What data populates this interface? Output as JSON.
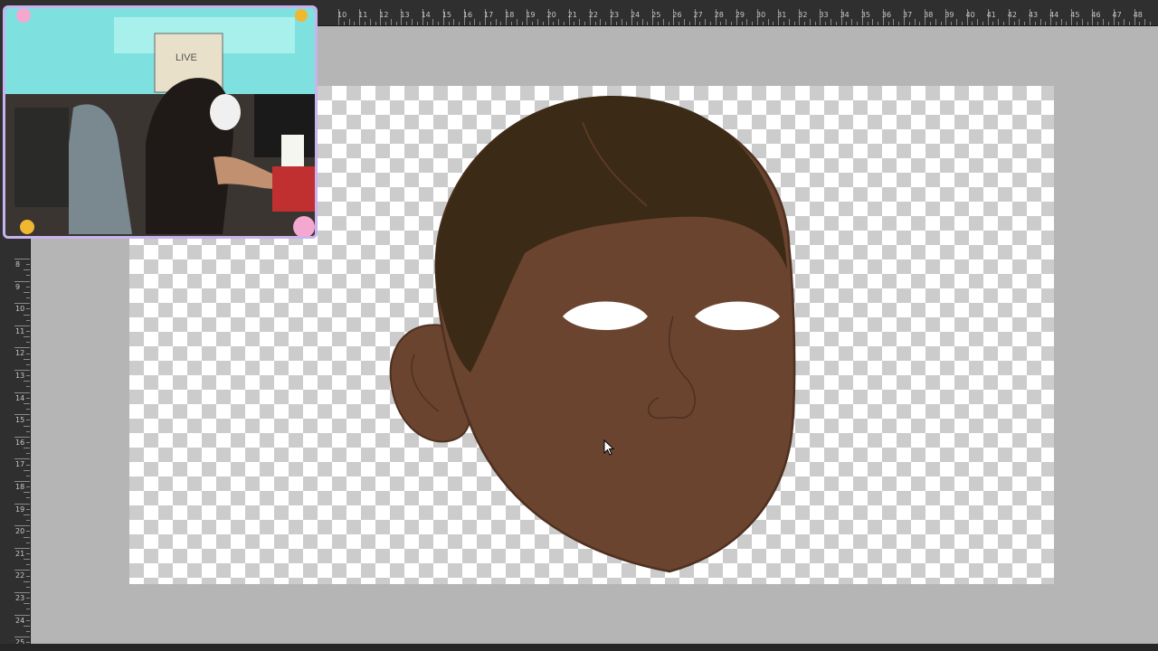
{
  "rulers": {
    "top_labels": [
      "10",
      "11",
      "12",
      "13",
      "14",
      "15",
      "16",
      "17",
      "18",
      "19",
      "20",
      "21",
      "22",
      "23",
      "24",
      "25",
      "26",
      "27",
      "28",
      "29",
      "30",
      "31",
      "32",
      "33",
      "34",
      "35",
      "36",
      "37",
      "38",
      "39",
      "40",
      "41",
      "42",
      "43",
      "44",
      "45",
      "46",
      "47",
      "48"
    ],
    "left_labels": [
      "8",
      "9",
      "10",
      "11",
      "12",
      "13",
      "14",
      "15",
      "16",
      "17",
      "18",
      "19",
      "20",
      "21",
      "22",
      "23",
      "24",
      "25"
    ]
  },
  "webcam": {
    "sign_text": "LIVE"
  },
  "canvas": {
    "background": "transparent-checkerboard"
  },
  "artwork": {
    "subject": "cartoon face",
    "skin_color": "#6b4430",
    "hair_color": "#3a2a16",
    "outline_color": "#4e3020",
    "eye_color": "#ffffff"
  },
  "icons": {
    "expand": "expand-icon",
    "cursor": "mouse-pointer-icon"
  }
}
